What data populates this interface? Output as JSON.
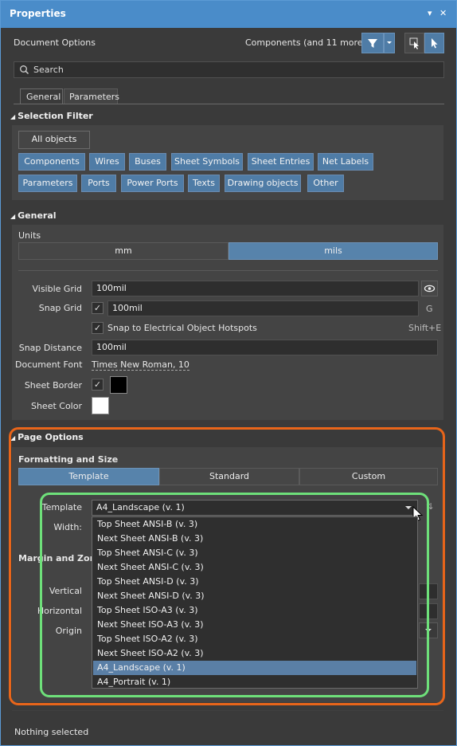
{
  "panel": {
    "title": "Properties",
    "pin_glyph": "▾",
    "close_glyph": "✕",
    "doc_options": "Document Options",
    "components_label": "Components (and 11 more)",
    "search_placeholder": "Search",
    "tabs": [
      "General",
      "Parameters"
    ],
    "footer": "Nothing selected"
  },
  "selection_filter": {
    "title": "Selection Filter",
    "all_objects": "All objects",
    "row1": [
      "Components",
      "Wires",
      "Buses",
      "Sheet Symbols",
      "Sheet Entries",
      "Net Labels"
    ],
    "row2": [
      "Parameters",
      "Ports",
      "Power Ports",
      "Texts",
      "Drawing objects",
      "Other"
    ]
  },
  "general": {
    "title": "General",
    "units_label": "Units",
    "units": [
      "mm",
      "mils"
    ],
    "units_selected": "mils",
    "visible_grid_label": "Visible Grid",
    "visible_grid_value": "100mil",
    "snap_grid_label": "Snap Grid",
    "snap_grid_value": "100mil",
    "snap_grid_shortcut": "G",
    "snap_hotspots_label": "Snap to Electrical Object Hotspots",
    "snap_hotspots_shortcut": "Shift+E",
    "snap_distance_label": "Snap Distance",
    "snap_distance_value": "100mil",
    "doc_font_label": "Document Font",
    "doc_font_value": "Times New Roman, 10",
    "sheet_border_label": "Sheet Border",
    "sheet_color_label": "Sheet Color",
    "sheet_border_color": "#000000",
    "sheet_color": "#ffffff"
  },
  "page_options": {
    "title": "Page Options",
    "formatting_label": "Formatting and Size",
    "modes": [
      "Template",
      "Standard",
      "Custom"
    ],
    "mode_selected": "Template",
    "template_label": "Template",
    "template_value": "A4_Landscape (v. 1)",
    "width_label": "Width:",
    "margin_label": "Margin and Zones",
    "vertical_label": "Vertical",
    "horizontal_label": "Horizontal",
    "origin_label": "Origin",
    "template_options": [
      "Top Sheet ANSI-B (v. 3)",
      "Next Sheet ANSI-B (v. 3)",
      "Top Sheet ANSI-C (v. 3)",
      "Next Sheet ANSI-C (v. 3)",
      "Top Sheet ANSI-D (v. 3)",
      "Next Sheet ANSI-D (v. 3)",
      "Top Sheet ISO-A3 (v. 3)",
      "Next Sheet ISO-A3 (v. 3)",
      "Top Sheet ISO-A2 (v. 3)",
      "Next Sheet ISO-A2 (v. 3)",
      "A4_Landscape (v. 1)",
      "A4_Portrait (v. 1)"
    ],
    "template_selected_index": 10
  },
  "colors": {
    "highlight_orange": "#e8651a",
    "highlight_green": "#6ee07a",
    "accent_blue": "#4a8cc9"
  }
}
